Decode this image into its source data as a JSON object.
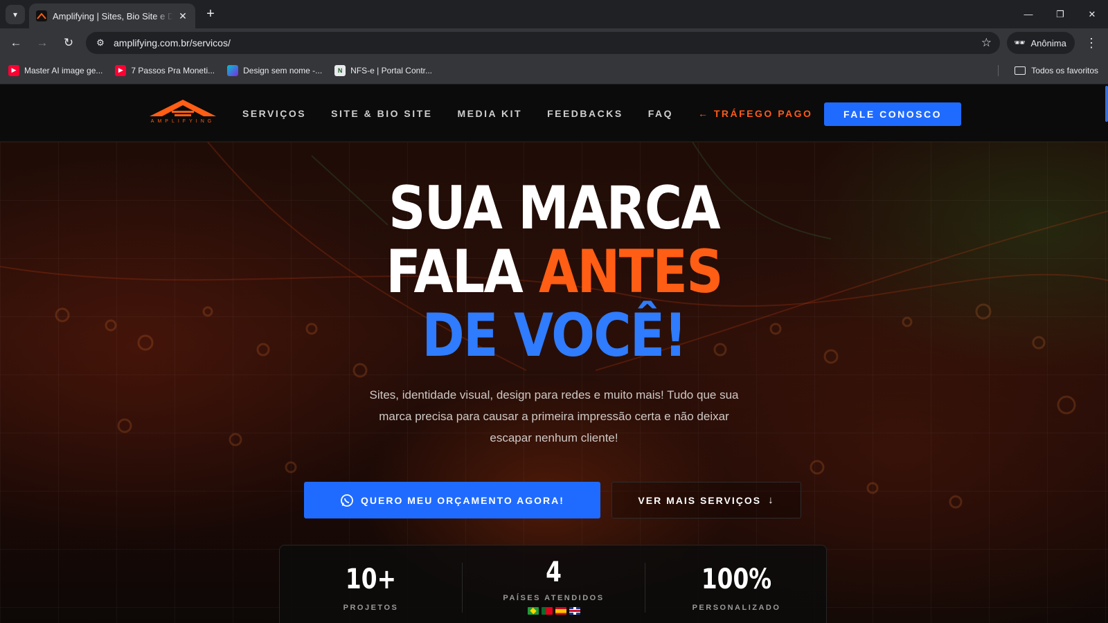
{
  "browser": {
    "tab_title": "Amplifying | Sites, Bio Site e Design",
    "url": "amplifying.com.br/servicos/",
    "profile_label": "Anônima",
    "bookmarks": [
      {
        "label": "Master AI image ge...",
        "icon": "youtube-icon"
      },
      {
        "label": "7 Passos Pra Moneti...",
        "icon": "youtube-icon"
      },
      {
        "label": "Design sem nome -...",
        "icon": "canva-icon"
      },
      {
        "label": "NFS-e | Portal Contr...",
        "icon": "nfse-icon"
      }
    ],
    "all_bookmarks_label": "Todos os favoritos"
  },
  "site": {
    "logo_text": "AMPLIFYING",
    "nav": [
      {
        "label": "SERVIÇOS"
      },
      {
        "label": "SITE & BIO SITE"
      },
      {
        "label": "MEDIA KIT"
      },
      {
        "label": "FEEDBACKS"
      },
      {
        "label": "FAQ"
      },
      {
        "label": "← TRÁFEGO PAGO"
      }
    ],
    "header_cta": "FALE CONOSCO"
  },
  "hero": {
    "line1": "SUA MARCA",
    "line2_white": "FALA ",
    "line2_orange": "ANTES",
    "line3": "DE VOCÊ!",
    "subtitle": "Sites, identidade visual, design para redes e muito mais! Tudo que sua marca precisa para causar a primeira impressão certa e não deixar escapar nenhum cliente!",
    "primary_button": "QUERO MEU ORÇAMENTO AGORA!",
    "secondary_button": "VER MAIS SERVIÇOS"
  },
  "stats": [
    {
      "value": "10+",
      "label": "PROJETOS"
    },
    {
      "value": "4",
      "label": "PAÍSES ATENDIDOS"
    },
    {
      "value": "100%",
      "label": "PERSONALIZADO"
    }
  ],
  "colors": {
    "accent_orange": "#ff5e14",
    "accent_blue": "#1f6bff",
    "header_bg": "#0b0b0b"
  }
}
